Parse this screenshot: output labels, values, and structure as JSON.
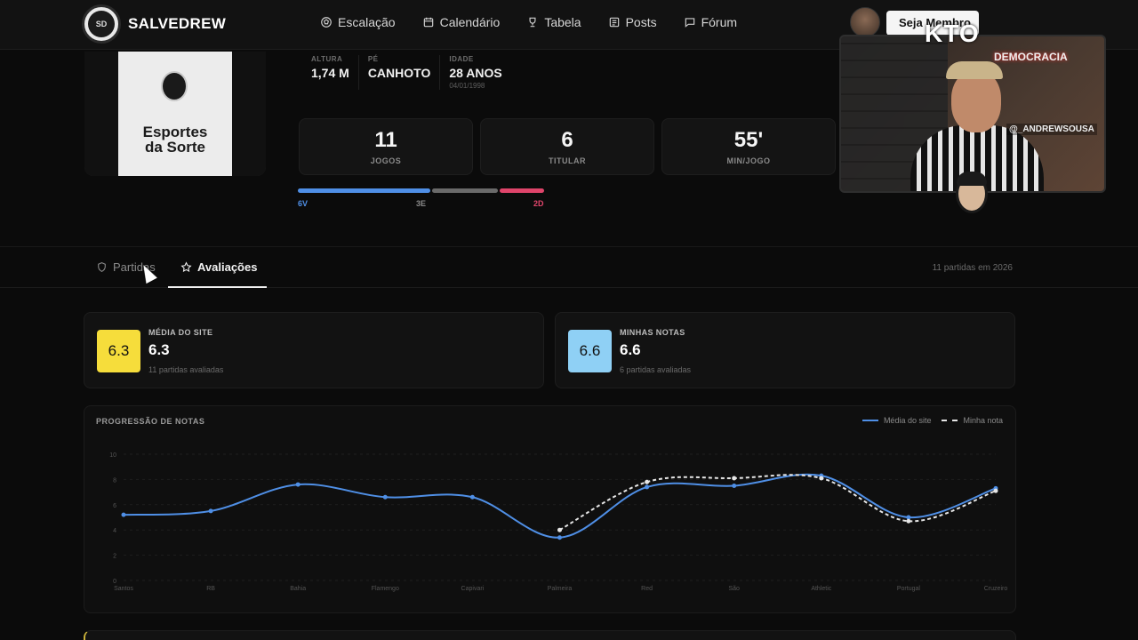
{
  "nav": {
    "brand": "SALVEDREW",
    "brand_logo_text": "SD",
    "items": [
      {
        "label": "Escalação",
        "icon": "soccer-ball-icon"
      },
      {
        "label": "Calendário",
        "icon": "calendar-icon"
      },
      {
        "label": "Tabela",
        "icon": "trophy-icon"
      },
      {
        "label": "Posts",
        "icon": "newspaper-icon"
      },
      {
        "label": "Fórum",
        "icon": "chat-icon"
      }
    ],
    "cta_label": "Seja Membro"
  },
  "overlay": {
    "sponsor": "KTO",
    "neon_sign": "DEMOCRACIA",
    "handle": "@_ANDREWSOUSA"
  },
  "player": {
    "jersey_sponsor_line1": "Esportes",
    "jersey_sponsor_line2": "da Sorte",
    "info": [
      {
        "label": "ALTURA",
        "value": "1,74 M",
        "sub": ""
      },
      {
        "label": "PÉ",
        "value": "CANHOTO",
        "sub": ""
      },
      {
        "label": "IDADE",
        "value": "28 ANOS",
        "sub": "04/01/1998"
      }
    ],
    "stats": [
      {
        "value": "11",
        "label": "JOGOS"
      },
      {
        "value": "6",
        "label": "TITULAR"
      },
      {
        "value": "55'",
        "label": "MIN/JOGO"
      }
    ],
    "record": {
      "wins": 6,
      "draws": 3,
      "losses": 2,
      "wins_label": "6V",
      "draws_label": "3E",
      "losses_label": "2D",
      "colors": {
        "wins": "#4f8fe6",
        "draws": "#6a6a6a",
        "losses": "#e0456b"
      }
    }
  },
  "tabs": {
    "items": [
      {
        "label": "Partidas",
        "icon": "shield-icon",
        "active": false
      },
      {
        "label": "Avaliações",
        "icon": "star-icon",
        "active": true
      }
    ],
    "meta": "11 partidas em 2026"
  },
  "ratings": {
    "site": {
      "title": "MÉDIA DO SITE",
      "chip": "6.3",
      "value": "6.3",
      "sub": "11 partidas avaliadas",
      "color": "#f6dd3b"
    },
    "mine": {
      "title": "MINHAS NOTAS",
      "chip": "6.6",
      "value": "6.6",
      "sub": "6 partidas avaliadas",
      "color": "#8fd0f5"
    }
  },
  "chart_data": {
    "type": "line",
    "title": "PROGRESSÃO DE NOTAS",
    "categories": [
      "Santos",
      "RB",
      "Bahia",
      "Flamengo",
      "Capivari",
      "Palmeira",
      "Red",
      "São",
      "Athletic",
      "Portugal",
      "Cruzeiro"
    ],
    "ylim": [
      0,
      10
    ],
    "yticks": [
      0,
      2,
      4,
      6,
      8,
      10
    ],
    "grid": true,
    "legend": "top-right",
    "series": [
      {
        "name": "Média do site",
        "color": "#4f8fe6",
        "dashed": false,
        "values": [
          5.2,
          5.5,
          7.6,
          6.6,
          6.6,
          3.4,
          7.4,
          7.5,
          8.3,
          5.0,
          7.3
        ]
      },
      {
        "name": "Minha nota",
        "color": "#e6e6e6",
        "dashed": true,
        "values": [
          null,
          null,
          null,
          null,
          null,
          4.0,
          7.8,
          8.1,
          8.1,
          4.7,
          7.1
        ]
      }
    ]
  }
}
